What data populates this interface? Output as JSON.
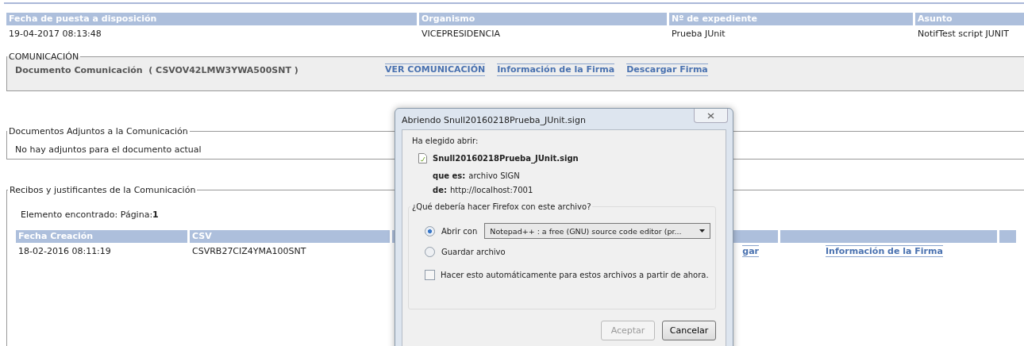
{
  "header_table": {
    "columns": [
      "Fecha de puesta a disposición",
      "Organismo",
      "Nº de expediente",
      "Asunto"
    ],
    "rows": [
      [
        "19-04-2017 08:13:48",
        "VICEPRESIDENCIA",
        "Prueba JUnit",
        "NotifTest script JUNIT"
      ]
    ]
  },
  "communication": {
    "legend": "COMUNICACIÓN",
    "document": "Documento Comunicación  ( CSVOV42LMW3YWA500SNT )",
    "links": [
      "VER COMUNICACIÓN",
      "Información de la Firma",
      "Descargar Firma"
    ]
  },
  "attachments": {
    "legend": "Documentos Adjuntos a la Comunicación",
    "message": "No hay adjuntos para el documento actual"
  },
  "receipts": {
    "legend": "Recibos y justificantes de la Comunicación",
    "found": "Elemento encontrado: Página:**1**",
    "columns": [
      "Fecha Creación",
      "CSV"
    ],
    "rows": [
      {
        "date": "18-02-2016 08:11:19",
        "csv": "CSVRB27CIZ4YMA100SNT",
        "links": [
          "gar",
          "Información de la Firma"
        ]
      }
    ]
  },
  "dialog": {
    "title": "Abriendo Snull20160218Prueba_JUnit.sign",
    "intro": "Ha elegido abrir:",
    "file_name": "Snull20160218Prueba_JUnit.sign",
    "type_label": "que es:",
    "type_value": "archivo SIGN",
    "from_label": "de:",
    "from_value": "http://localhost:7001",
    "question": "¿Qué debería hacer Firefox con este archivo?",
    "options": [
      {
        "label": "Abrir con",
        "selected": true,
        "kind": "open"
      },
      {
        "label": "Guardar archivo",
        "selected": false,
        "kind": "save"
      }
    ],
    "app": "Notepad++ : a free (GNU) source code editor (pr...",
    "remember": {
      "label": "Hacer esto automáticamente para estos archivos a partir de ahora.",
      "checked": false
    },
    "buttons": [
      {
        "label": "Aceptar",
        "disabled": true
      },
      {
        "label": "Cancelar",
        "disabled": false
      }
    ]
  }
}
